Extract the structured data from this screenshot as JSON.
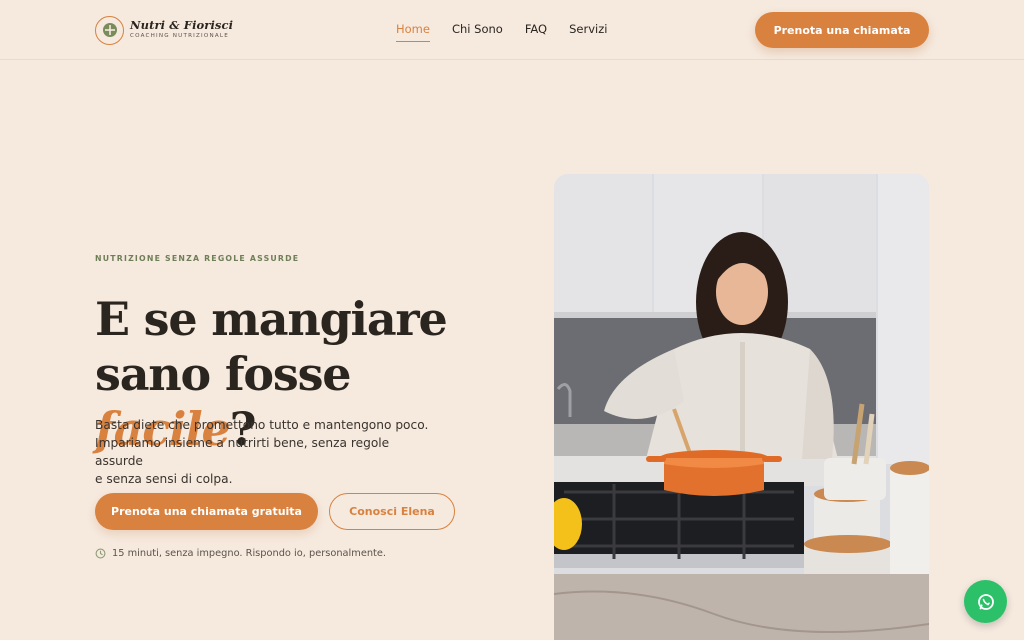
{
  "brand": {
    "name": "Nutri & Fiorisci",
    "tagline": "COACHING NUTRIZIONALE",
    "accent_color": "#d9813f",
    "eyebrow_color": "#6f7e56"
  },
  "nav": {
    "items": [
      {
        "label": "Home",
        "active": true
      },
      {
        "label": "Chi Sono",
        "active": false
      },
      {
        "label": "FAQ",
        "active": false
      },
      {
        "label": "Servizi",
        "active": false
      }
    ],
    "cta_label": "Prenota una chiamata"
  },
  "hero": {
    "eyebrow": "NUTRIZIONE SENZA REGOLE ASSURDE",
    "headline_line1": "E se mangiare",
    "headline_line2_pre": "sano fosse ",
    "headline_accent": "facile",
    "headline_end": "?",
    "body_line1": "Basta diete che promettono tutto e mantengono poco.",
    "body_line2": "Impariamo insieme a nutrirti bene, senza regole assurde",
    "body_line3": "e senza sensi di colpa.",
    "primary_cta": "Prenota una chiamata gratuita",
    "secondary_cta": "Conosci Elena",
    "note": "15 minuti, senza impegno. Rispondo io, personalmente.",
    "image_icon": "kitchen-photo"
  },
  "floating": {
    "whatsapp_icon": "whatsapp-icon",
    "whatsapp_color": "#2cc069"
  }
}
